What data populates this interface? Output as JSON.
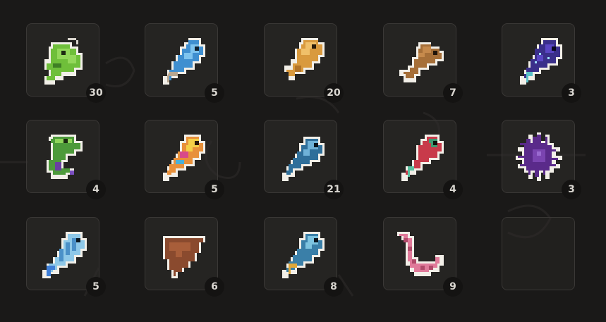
{
  "inventory": {
    "slots": [
      {
        "item": "green-frog-fish",
        "count": "30"
      },
      {
        "item": "blue-fish",
        "count": "5"
      },
      {
        "item": "golden-fish",
        "count": "20"
      },
      {
        "item": "brown-fish",
        "count": "7"
      },
      {
        "item": "galaxy-fish",
        "count": "3"
      },
      {
        "item": "green-eel-fish",
        "count": "4"
      },
      {
        "item": "rainbow-fish",
        "count": "5"
      },
      {
        "item": "teal-fish",
        "count": "21"
      },
      {
        "item": "red-green-fish",
        "count": "4"
      },
      {
        "item": "purple-urchin",
        "count": "3"
      },
      {
        "item": "striped-blue-fish",
        "count": "5"
      },
      {
        "item": "brown-ray",
        "count": "6"
      },
      {
        "item": "blue-yellow-fish",
        "count": "8"
      },
      {
        "item": "pink-worm",
        "count": "9"
      },
      {
        "item": "empty",
        "count": ""
      }
    ]
  },
  "colors": {
    "background": "#1a1918",
    "slot_border": "#3a3836",
    "badge": "#141312",
    "badge_text": "#d9d6d0"
  }
}
